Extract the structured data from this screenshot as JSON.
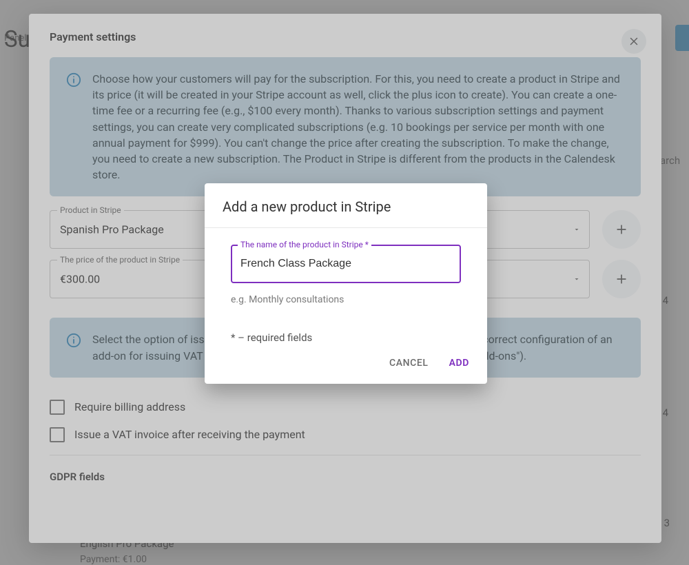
{
  "page": {
    "breadcrumb": "Panel",
    "title": "Su",
    "search_placeholder": "earch",
    "row_trailing_a": "4",
    "row_trailing_b": "4",
    "row_trailing_c": "3",
    "english_line": "English Pro Package",
    "payment_line": "Payment: €1.00"
  },
  "panel": {
    "title": "Payment settings",
    "info1": "Choose how your customers will pay for the subscription. For this, you need to create a product in Stripe and its price (it will be created in your Stripe account as well, click the plus icon to create). You can create a one-time fee or a recurring fee (e.g., $100 every month). Thanks to various subscription settings and payment settings, you can create very complicated subscriptions (e.g. 10 bookings per service per month with one annual payment for $999). You can't change the price after creating the subscription. To make the change, you need to create a new subscription. The Product in Stripe is different from the products in the Calendesk store.",
    "product_label": "Product in Stripe",
    "product_value": "Spanish Pro Package",
    "price_label": "The price of the product in Stripe",
    "price_value": "€300.00",
    "info2": "Select the option of issuing                                                                                ue an invoice for the payment transaction (Requires correct configuration of an add-on for issuing VAT invoices, e.g., InvoiceOcean, which can be found in the \"Add-ons\").",
    "check1": "Require billing address",
    "check2": "Issue a VAT invoice after receiving the payment",
    "gdpr": "GDPR fields"
  },
  "modal": {
    "title": "Add a new product in Stripe",
    "name_label": "The name of the product in Stripe *",
    "name_value": "French Class Package",
    "hint": "e.g. Monthly consultations",
    "required_note": "* – required fields",
    "cancel": "CANCEL",
    "add": "ADD"
  },
  "colors": {
    "accent": "#7e2fbf",
    "info_bg": "#c1d6e2",
    "info_icon": "#2f82b4"
  }
}
